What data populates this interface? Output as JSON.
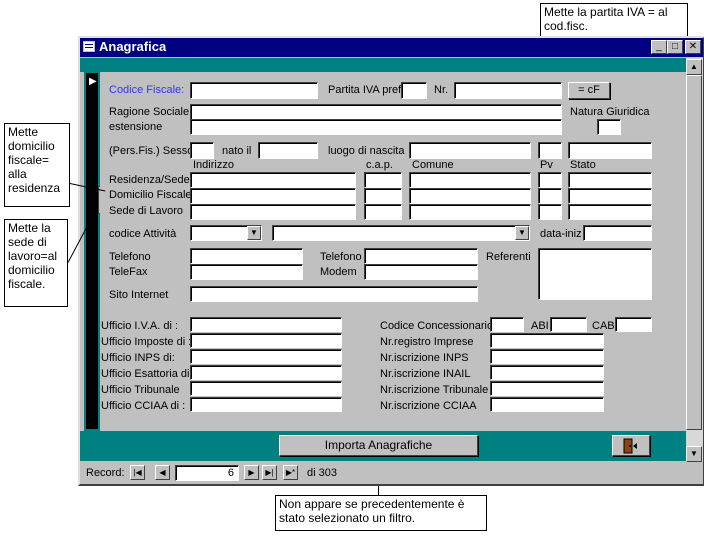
{
  "window": {
    "title": "Anagrafica"
  },
  "callouts": {
    "top": "Mette la partita IVA = al cod.fisc.",
    "residenza": "Mette domicilio fiscale= alla residenza",
    "sede": "Mette la sede di lavoro=al domicilio fiscale.",
    "filtro": "Non appare se precedentemente è stato selezionato un filtro."
  },
  "labels": {
    "codice_fiscale": "Codice Fiscale:",
    "partita_iva_pref": "Partita IVA pref",
    "nr": "Nr.",
    "ragione_sociale": "Ragione Sociale",
    "estensione": "estensione",
    "natura_giuridica": "Natura Giuridica",
    "pers_fis_sesso": "(Pers.Fis.) Sesso",
    "nato_il": "nato il",
    "luogo_nascita": "luogo di nascita",
    "indirizzo": "Indirizzo",
    "cap": "c.a.p.",
    "comune": "Comune",
    "pv": "Pv",
    "stato": "Stato",
    "residenza_sede": "Residenza/Sede",
    "domicilio_fiscale": "Domicilio Fiscale",
    "sede_lavoro": "Sede di Lavoro",
    "codice_attivita": "codice Attività",
    "data_iniz": "data-iniz",
    "telefono1": "Telefono",
    "telefax": "TeleFax",
    "telefono2": "Telefono",
    "modem": "Modem",
    "referenti": "Referenti",
    "sito_internet": "Sito Internet",
    "ufficio_iva": "Ufficio I.V.A. di :",
    "ufficio_imposte": "Ufficio Imposte di :",
    "ufficio_inps": "Ufficio INPS di:",
    "ufficio_esattoria": "Ufficio Esattoria di:",
    "ufficio_tribunale": "Ufficio Tribunale",
    "ufficio_cciaa": "Ufficio CCIAA di :",
    "codice_concessionario": "Codice Concessionario",
    "abi": "ABI",
    "cab": "CAB",
    "nr_registro_imprese": "Nr.registro Imprese",
    "nr_iscrizione_inps": "Nr.iscrizione INPS",
    "nr_iscrizione_inail": "Nr.iscrizione INAIL",
    "nr_iscrizione_tribunale": "Nr.iscrizione Tribunale",
    "nr_iscrizione_cciaa": "Nr.iscrizione CCIAA"
  },
  "buttons": {
    "cf": "= cF",
    "importa": "Importa Anagrafiche"
  },
  "recordnav": {
    "label": "Record:",
    "current": "6",
    "total": "di 303"
  },
  "icons": {
    "window": "form-icon",
    "exit": "exit-door-icon"
  },
  "colors": {
    "titlebar": "#000080",
    "footer": "#008080",
    "label_blue": "#3333ff",
    "form_bg": "#c0c0c0"
  }
}
